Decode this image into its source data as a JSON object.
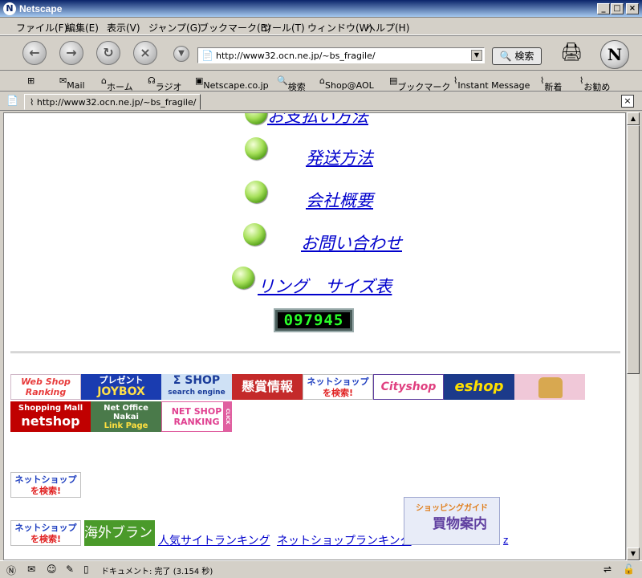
{
  "window": {
    "title": "Netscape",
    "minimize": "_",
    "maximize": "□",
    "close": "×"
  },
  "menu": [
    "ファイル(F)",
    "編集(E)",
    "表示(V)",
    "ジャンプ(G)",
    "ブックマーク(B)",
    "ツール(T)",
    "ウィンドウ(W)",
    "ヘルプ(H)"
  ],
  "navigation": {
    "url": "http://www32.ocn.ne.jp/~bs_fragile/",
    "search_label": "検索"
  },
  "personal_toolbar": [
    "Mail",
    "ホーム",
    "ラジオ",
    "Netscape.co.jp",
    "検索",
    "Shop@AOL",
    "ブックマーク",
    "Instant Message",
    "新着",
    "お勧め"
  ],
  "tab": {
    "label": "http://www32.ocn.ne.jp/~bs_fragile/"
  },
  "page": {
    "links": [
      {
        "label": "お支払い方法"
      },
      {
        "label": "発送方法"
      },
      {
        "label": "会社概要"
      },
      {
        "label": "お問い合わせ"
      },
      {
        "label": "リング　サイズ表"
      }
    ],
    "counter": "097945",
    "banners": {
      "webshop": [
        "Web Shop",
        "Ranking"
      ],
      "joybox": [
        "プレゼント",
        "JOYBOX"
      ],
      "sigma": [
        "Σ SHOP",
        "search engine"
      ],
      "kenshou": "懸賞情報",
      "netshop_search": [
        "ネットショップ",
        "を検索!"
      ],
      "cityshop": "Cityshop",
      "eshop": "eshop",
      "mall": [
        "Shopping Mall",
        "netshop"
      ],
      "nakai": [
        "Net Office",
        "Nakai",
        "Link Page"
      ],
      "ranking": [
        "NET SHOP",
        "RANKING",
        "CLICK"
      ],
      "kaigai": "海外ブランド",
      "guide": [
        "ショッピングガイド",
        "買物案内"
      ]
    },
    "text_links": {
      "ninki": "人気サイトランキング",
      "netshop_ranking": "ネットショップランキング",
      "z": "z"
    }
  },
  "status": {
    "text": "ドキュメント: 完了 (3.154 秒)"
  }
}
